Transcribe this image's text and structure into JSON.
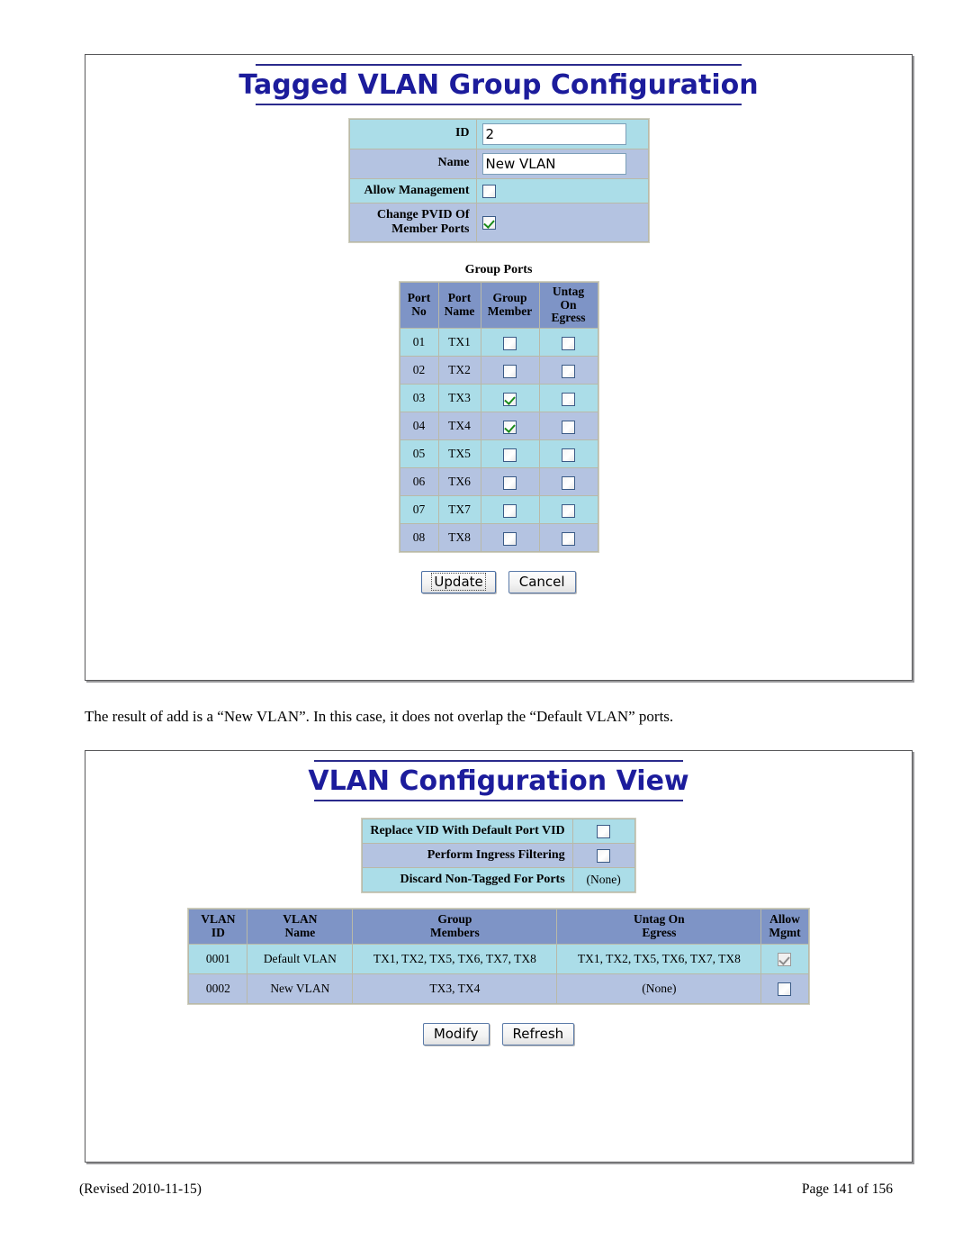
{
  "document": {
    "caption": "The result of add is a “New VLAN”. In this case, it does not overlap the “Default VLAN” ports.",
    "footer_left": "(Revised 2010-11-15)",
    "footer_right": "Page 141 of 156"
  },
  "colors": {
    "title_blue": "#1c1c9c",
    "row_cyan": "#abdde8",
    "row_lavender": "#b4c3e1",
    "table_header": "#7e94c6",
    "check_green": "#1a8a1a"
  },
  "tagged_vlan": {
    "title": "Tagged VLAN Group Configuration",
    "form": {
      "id_label": "ID",
      "id_value": "2",
      "name_label": "Name",
      "name_value": "New VLAN",
      "allow_management_label": "Allow Management",
      "allow_management_checked": false,
      "change_pvid_label_line1": "Change PVID Of",
      "change_pvid_label_line2": "Member Ports",
      "change_pvid_checked": true
    },
    "group_ports": {
      "caption": "Group Ports",
      "headers": {
        "port_no_line1": "Port",
        "port_no_line2": "No",
        "port_name_line1": "Port",
        "port_name_line2": "Name",
        "group_member_line1": "Group",
        "group_member_line2": "Member",
        "untag_egress_line1": "Untag On",
        "untag_egress_line2": "Egress"
      },
      "rows": [
        {
          "no": "01",
          "name": "TX1",
          "member": false,
          "untag": false
        },
        {
          "no": "02",
          "name": "TX2",
          "member": false,
          "untag": false
        },
        {
          "no": "03",
          "name": "TX3",
          "member": true,
          "untag": false
        },
        {
          "no": "04",
          "name": "TX4",
          "member": true,
          "untag": false
        },
        {
          "no": "05",
          "name": "TX5",
          "member": false,
          "untag": false
        },
        {
          "no": "06",
          "name": "TX6",
          "member": false,
          "untag": false
        },
        {
          "no": "07",
          "name": "TX7",
          "member": false,
          "untag": false
        },
        {
          "no": "08",
          "name": "TX8",
          "member": false,
          "untag": false
        }
      ]
    },
    "buttons": {
      "update": "Update",
      "cancel": "Cancel"
    }
  },
  "vlan_view": {
    "title": "VLAN Configuration View",
    "options": {
      "replace_vid_label": "Replace VID With Default Port VID",
      "replace_vid_checked": false,
      "ingress_filtering_label": "Perform Ingress Filtering",
      "ingress_filtering_checked": false,
      "discard_non_tagged_label": "Discard Non-Tagged For Ports",
      "discard_non_tagged_value": "(None)"
    },
    "table": {
      "headers": {
        "vlan_id_line1": "VLAN",
        "vlan_id_line2": "ID",
        "vlan_name_line1": "VLAN",
        "vlan_name_line2": "Name",
        "group_members_line1": "Group",
        "group_members_line2": "Members",
        "untag_egress_line1": "Untag On",
        "untag_egress_line2": "Egress",
        "allow_mgmt_line1": "Allow",
        "allow_mgmt_line2": "Mgmt"
      },
      "rows": [
        {
          "vlan_id": "0001",
          "vlan_name": "Default VLAN",
          "group_members": "TX1, TX2, TX5, TX6, TX7, TX8",
          "untag_on_egress": "TX1, TX2, TX5, TX6, TX7, TX8",
          "allow_mgmt": true,
          "allow_mgmt_disabled": true
        },
        {
          "vlan_id": "0002",
          "vlan_name": "New VLAN",
          "group_members": "TX3, TX4",
          "untag_on_egress": "(None)",
          "allow_mgmt": false,
          "allow_mgmt_disabled": false
        }
      ]
    },
    "buttons": {
      "modify": "Modify",
      "refresh": "Refresh"
    }
  }
}
